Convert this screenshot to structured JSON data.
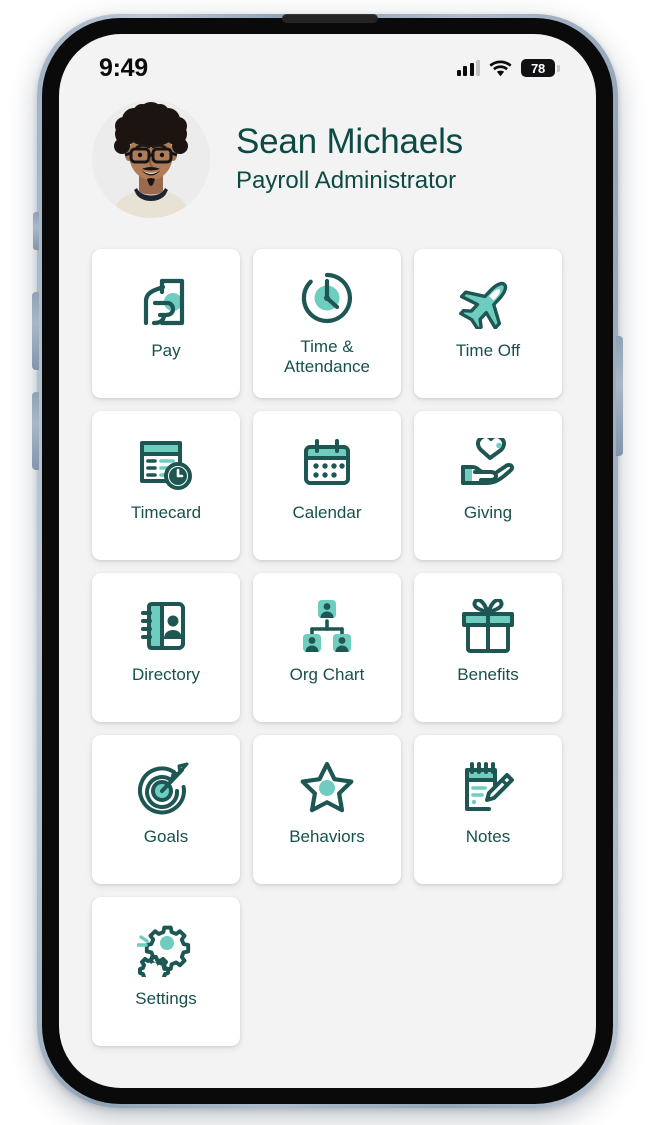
{
  "status_bar": {
    "time": "9:49",
    "signal_icon": "cellular-signal-icon",
    "wifi_icon": "wifi-icon",
    "battery_level": "78",
    "battery_icon": "battery-icon"
  },
  "profile": {
    "avatar_icon": "user-avatar-photo",
    "name": "Sean Michaels",
    "role": "Payroll Administrator"
  },
  "colors": {
    "screen_background": "#f3f3f3",
    "tile_background": "#ffffff",
    "icon_dark_teal": "#1d5652",
    "icon_light_teal": "#6ecdbf",
    "text_teal": "#17514d",
    "heading_teal": "#0c4a45",
    "phone_frame": "#a3b3c4",
    "phone_bezel": "#0a0a0b"
  },
  "grid": {
    "tiles": [
      {
        "label": "Pay",
        "icon": "pay-hand-document-icon"
      },
      {
        "label": "Time & Attendance",
        "icon": "clock-icon"
      },
      {
        "label": "Time Off",
        "icon": "airplane-icon"
      },
      {
        "label": "Timecard",
        "icon": "timecard-clock-icon"
      },
      {
        "label": "Calendar",
        "icon": "calendar-icon"
      },
      {
        "label": "Giving",
        "icon": "hand-heart-icon"
      },
      {
        "label": "Directory",
        "icon": "address-book-icon"
      },
      {
        "label": "Org Chart",
        "icon": "org-chart-icon"
      },
      {
        "label": "Benefits",
        "icon": "gift-icon"
      },
      {
        "label": "Goals",
        "icon": "target-arrow-icon"
      },
      {
        "label": "Behaviors",
        "icon": "star-icon"
      },
      {
        "label": "Notes",
        "icon": "notepad-pencil-icon"
      },
      {
        "label": "Settings",
        "icon": "gears-icon"
      }
    ]
  }
}
